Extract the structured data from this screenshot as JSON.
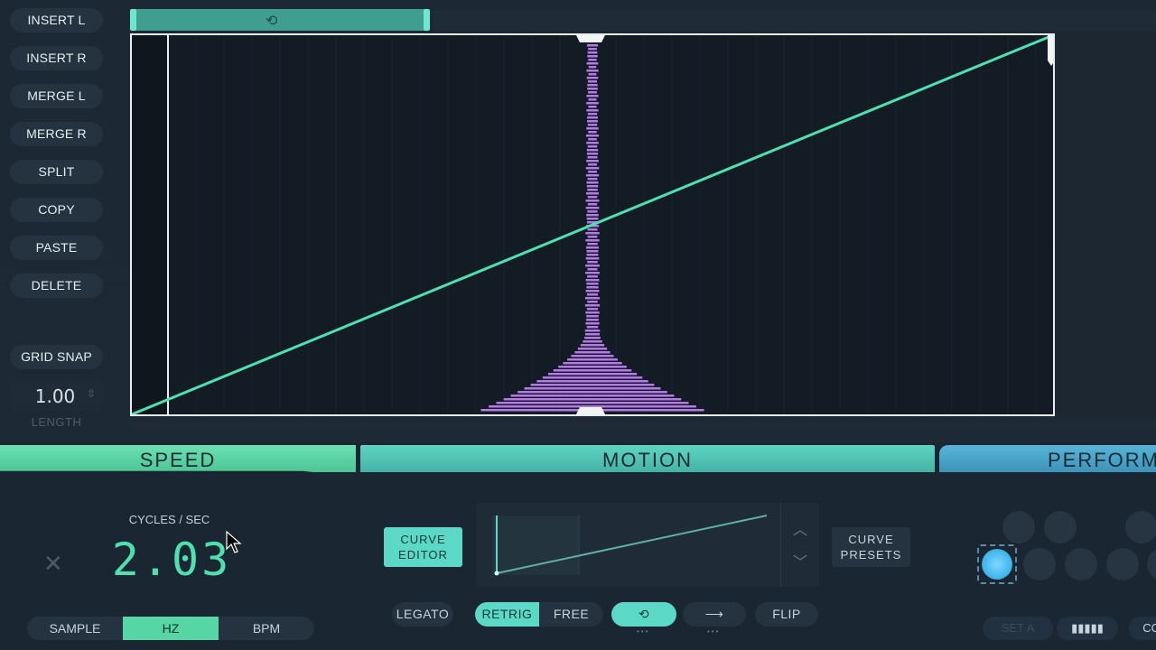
{
  "tools": {
    "insert_l": "INSERT L",
    "insert_r": "INSERT R",
    "merge_l": "MERGE L",
    "merge_r": "MERGE R",
    "split": "SPLIT",
    "copy": "COPY",
    "paste": "PASTE",
    "delete": "DELETE",
    "grid_snap": "GRID SNAP",
    "length_value": "1.00",
    "length_label": "LENGTH"
  },
  "loop": {
    "icon": "loop-icon"
  },
  "sections": {
    "speed": "SPEED",
    "motion": "MOTION",
    "perform": "PERFORM"
  },
  "speed": {
    "unit_label": "CYCLES / SEC",
    "value": "2.03",
    "modes": [
      "SAMPLE",
      "HZ",
      "BPM"
    ],
    "active_mode": "HZ"
  },
  "motion": {
    "curve_editor": [
      "CURVE",
      "EDITOR"
    ],
    "curve_presets": [
      "CURVE",
      "PRESETS"
    ],
    "legato": "LEGATO",
    "retrig": "RETRIG",
    "free": "FREE",
    "flip": "FLIP",
    "loop_icon": "loop-icon",
    "direction_icon": "arrow-right-icon"
  },
  "perform": {
    "set_label": "SET A",
    "keys_icon": "piano-keys-icon",
    "co_label": "CO"
  },
  "colors": {
    "curve": "#4fe0b0",
    "waveform": "#b57ae8",
    "speed_accent": "#56d6a5",
    "motion_accent": "#5cd8c6",
    "perform_accent": "#4aa9d3"
  }
}
